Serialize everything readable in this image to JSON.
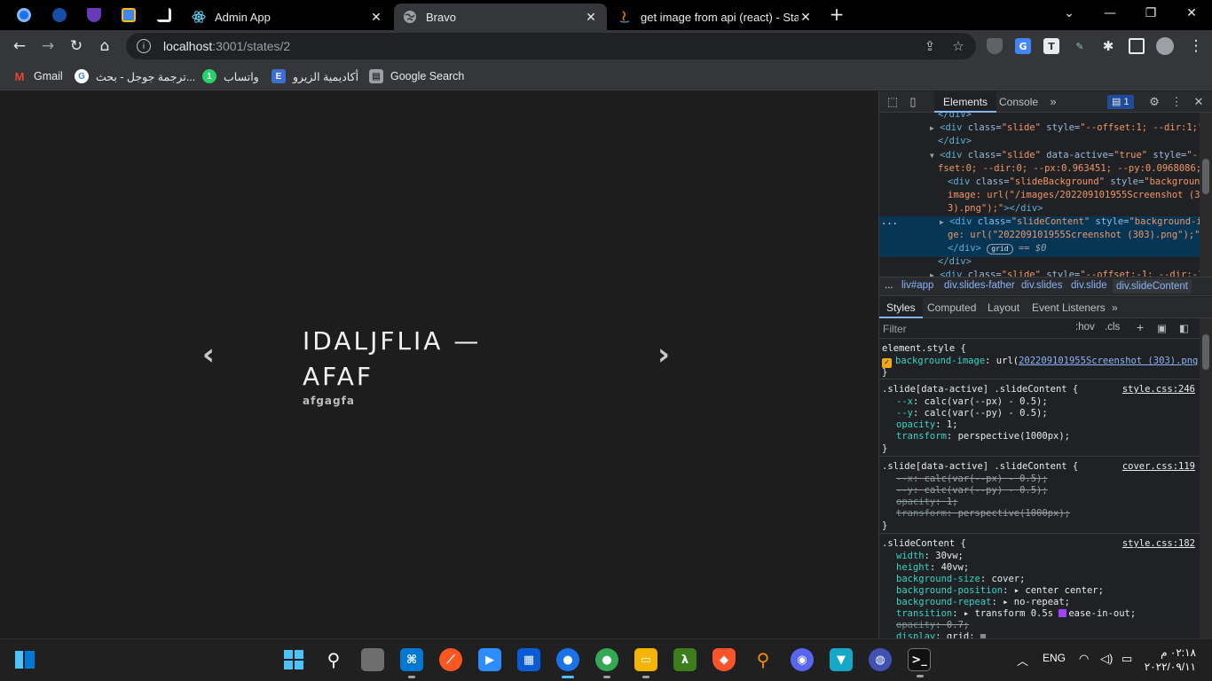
{
  "browser": {
    "tabs": [
      {
        "title": "Admin App",
        "close": "✕"
      },
      {
        "title": "Bravo",
        "close": "✕"
      },
      {
        "title": "get image from api (react) - Stack",
        "close": "✕"
      }
    ],
    "new_tab": "+",
    "window_controls": {
      "dropdown": "⌄",
      "minimize": "—",
      "restore": "❐",
      "close": "✕"
    },
    "url_host": "localhost",
    "url_path": ":3001/states/2",
    "bookmarks": [
      "Gmail",
      "ترجمة جوجل - بحث...",
      "واتساب",
      "أكاديمية الزيرو",
      "Google Search"
    ]
  },
  "page": {
    "prev_arrow": "‹",
    "next_arrow": "›",
    "title": "IDALJFLIA — AFAF",
    "subtitle": "afgagfa"
  },
  "devtools": {
    "tabs": [
      "Elements",
      "Console"
    ],
    "more": "»",
    "issues_count": "1",
    "dom_lines": {
      "l0": "</div>",
      "l1_tag": "<div ",
      "l1_attr": "class=",
      "l1_val": "\"slide\"",
      "l1_attr2": " style=",
      "l1_val2": "\"--offset:1; --dir:1;\"",
      "l1_end": ">…",
      "l2": "</div>",
      "l3_tag": "<div ",
      "l3_attr": "class=",
      "l3_val": "\"slide\"",
      "l3_attr2": " data-active=",
      "l3_val2": "\"true\"",
      "l3_attr3": " style=",
      "l3_val3": "\"--of",
      "l4": "fset:0; --dir:0; --px:0.963451; --py:0.0968086;\"",
      "l4_end": ">",
      "l5_tag": "<div ",
      "l5_attr": "class=",
      "l5_val": "\"slideBackground\"",
      "l5_attr2": " style=",
      "l5_val2": "\"background-",
      "l6": "image: url(\"/images/202209101955Screenshot (30",
      "l7": "3).png\");\"",
      "l7_end": "></div>",
      "l8_tag": "<div ",
      "l8_attr": "class=",
      "l8_val": "\"slideContent\"",
      "l8_attr2": " style=",
      "l8_val2": "\"background-ima",
      "l9": "ge: url(\"202209101955Screenshot (303).png\");\"",
      "l9_end": ">…",
      "l10": "</div>",
      "grid": "grid",
      "eq": "== $0",
      "l11": "</div>",
      "l12_tag": "<div ",
      "l12_attr": "class=",
      "l12_val": "\"slide\"",
      "l12_attr2": " style=",
      "l12_val2": "\"--offset:-1; --dir:-1;"
    },
    "dots": "...",
    "breadcrumbs": [
      "...",
      "liv#app",
      "div.slides-father",
      "div.slides",
      "div.slide",
      "div.slideContent"
    ],
    "style_tabs": [
      "Styles",
      "Computed",
      "Layout",
      "Event Listeners",
      "»"
    ],
    "filter_placeholder": "Filter",
    "hov": ":hov",
    "cls": ".cls",
    "rules": {
      "r0_sel": "element.style {",
      "r0_prop": "background-image",
      "r0_url": "202209101955Screenshot (303).png",
      "r1_sel": ".slide[data-active] .slideContent {",
      "r1_src": "style.css:246",
      "r1_p1": "--x",
      "r1_v1": "calc(var(--px) - 0.5);",
      "r1_p2": "--y",
      "r1_v2": "calc(var(--py) - 0.5);",
      "r1_p3": "opacity",
      "r1_v3": "1;",
      "r1_p4": "transform",
      "r1_v4": "perspective(1000px);",
      "r2_sel": ".slide[data-active] .slideContent {",
      "r2_src": "cover.css:119",
      "r3_sel": ".slideContent {",
      "r3_src": "style.css:182",
      "r3_p1": "width",
      "r3_v1": "30vw;",
      "r3_p2": "height",
      "r3_v2": "40vw;",
      "r3_p3": "background-size",
      "r3_v3": "cover;",
      "r3_p4": "background-position",
      "r3_v4": "center center;",
      "r3_p5": "background-repeat",
      "r3_v5": "no-repeat;",
      "r3_p6": "transition",
      "r3_v6": "transform 0.5s ",
      "r3_v6b": "ease-in-out;",
      "r3_p7": "opacity",
      "r3_v7": "0.7;",
      "r3_p8": "display",
      "r3_v8": "grid;",
      "close_brace": "}"
    }
  },
  "taskbar": {
    "lang": "ENG",
    "time": "٠٢:١٨ م",
    "date": "٢٠٢٢/٠٩/١١"
  },
  "colors": {
    "accent": "#8ab4f8",
    "selection": "#073655",
    "prop": "#35d4c7"
  }
}
